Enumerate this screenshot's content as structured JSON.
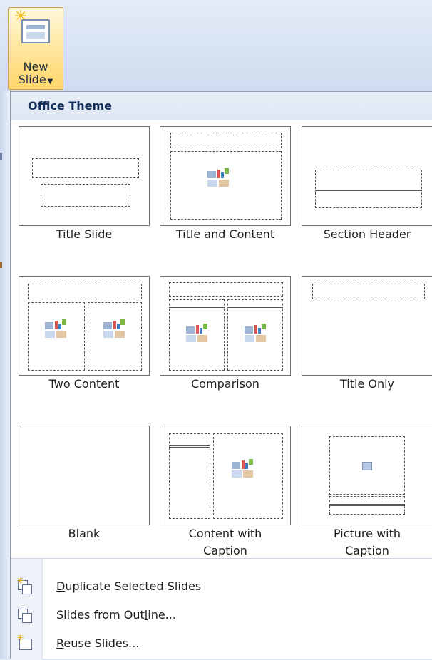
{
  "new_slide": {
    "label_line1": "New",
    "label_line2": "Slide"
  },
  "gallery": {
    "header": "Office Theme",
    "layouts": [
      {
        "label": "Title Slide"
      },
      {
        "label": "Title and Content"
      },
      {
        "label": "Section Header"
      },
      {
        "label": "Two Content"
      },
      {
        "label": "Comparison"
      },
      {
        "label": "Title Only"
      },
      {
        "label": "Blank"
      },
      {
        "label_line1": "Content with",
        "label_line2": "Caption"
      },
      {
        "label_line1": "Picture with",
        "label_line2": "Caption"
      }
    ]
  },
  "menu": {
    "duplicate": {
      "mnemonic": "D",
      "rest": "uplicate Selected Slides"
    },
    "outline": {
      "before": "Slides from Out",
      "mnemonic": "l",
      "after": "ine..."
    },
    "reuse": {
      "mnemonic": "R",
      "rest": "euse Slides..."
    }
  }
}
